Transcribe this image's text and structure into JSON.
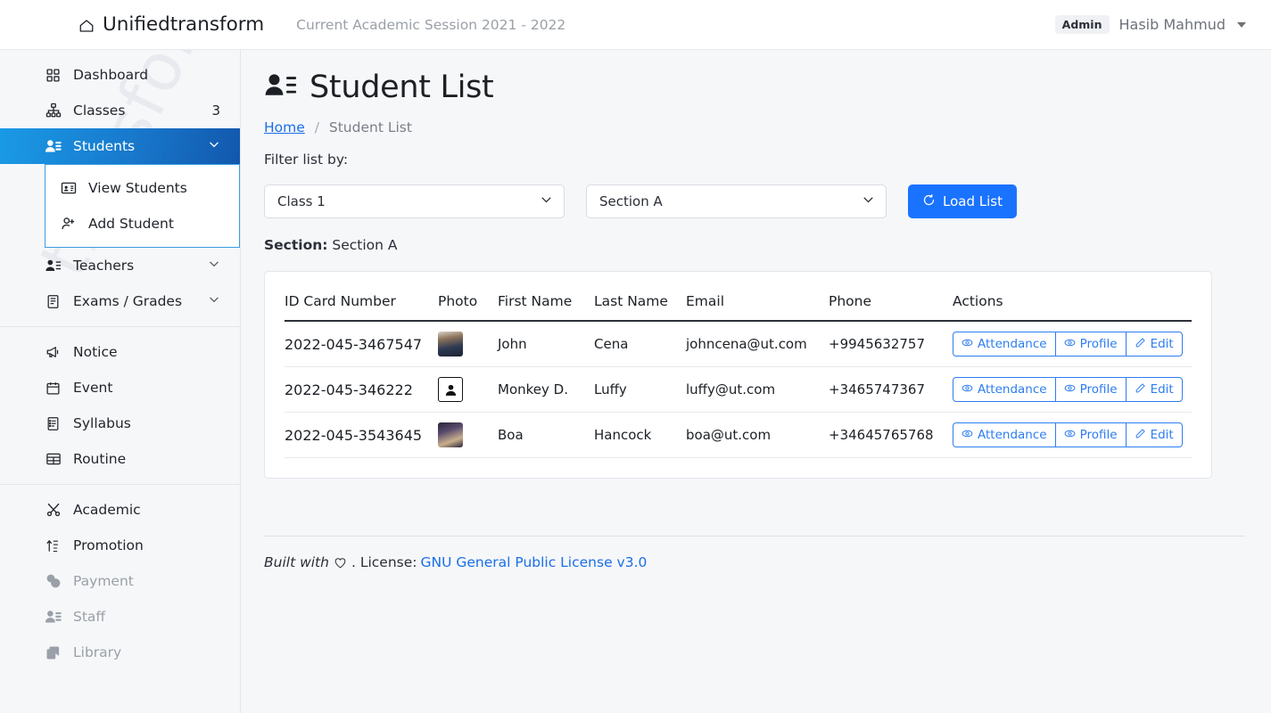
{
  "topbar": {
    "brand": "Unifiedtransform",
    "brand_icon": "home-icon",
    "session": "Current Academic Session 2021 - 2022",
    "role_badge": "Admin",
    "user_name": "Hasib Mahmud",
    "user_caret_icon": "chevron-down-icon"
  },
  "watermark": "transform",
  "sidebar": {
    "groups": [
      {
        "items": [
          {
            "label": "Dashboard",
            "icon": "grid-icon",
            "count": "",
            "expandable": false,
            "active": false,
            "muted": false
          },
          {
            "label": "Classes",
            "icon": "sitemap-icon",
            "count": "3",
            "expandable": false,
            "active": false,
            "muted": false
          },
          {
            "label": "Students",
            "icon": "users-icon",
            "count": "",
            "expandable": true,
            "active": true,
            "muted": false
          },
          {
            "label": "Teachers",
            "icon": "users-icon",
            "count": "",
            "expandable": true,
            "active": false,
            "muted": false
          },
          {
            "label": "Exams / Grades",
            "icon": "document-icon",
            "count": "",
            "expandable": true,
            "active": false,
            "muted": false
          }
        ]
      },
      {
        "items": [
          {
            "label": "Notice",
            "icon": "megaphone-icon",
            "count": "",
            "expandable": false,
            "active": false,
            "muted": false
          },
          {
            "label": "Event",
            "icon": "calendar-icon",
            "count": "",
            "expandable": false,
            "active": false,
            "muted": false
          },
          {
            "label": "Syllabus",
            "icon": "list-document-icon",
            "count": "",
            "expandable": false,
            "active": false,
            "muted": false
          },
          {
            "label": "Routine",
            "icon": "table-icon",
            "count": "",
            "expandable": false,
            "active": false,
            "muted": false
          }
        ]
      },
      {
        "items": [
          {
            "label": "Academic",
            "icon": "scissors-icon",
            "count": "",
            "expandable": false,
            "active": false,
            "muted": false
          },
          {
            "label": "Promotion",
            "icon": "sort-up-icon",
            "count": "",
            "expandable": false,
            "active": false,
            "muted": false
          },
          {
            "label": "Payment",
            "icon": "coins-icon",
            "count": "",
            "expandable": false,
            "active": false,
            "muted": true
          },
          {
            "label": "Staff",
            "icon": "users-icon",
            "count": "",
            "expandable": false,
            "active": false,
            "muted": true
          },
          {
            "label": "Library",
            "icon": "books-icon",
            "count": "",
            "expandable": false,
            "active": false,
            "muted": true
          }
        ]
      }
    ],
    "submenu": [
      {
        "label": "View Students",
        "icon": "id-card-icon"
      },
      {
        "label": "Add Student",
        "icon": "user-plus-icon"
      }
    ],
    "active_color": "#1878cc",
    "submenu_border_color": "#3a9ce0"
  },
  "main": {
    "title": "Student List",
    "title_icon": "users-list-icon",
    "breadcrumb": {
      "home": "Home",
      "separator": "/",
      "current": "Student List"
    },
    "filter_label": "Filter list by:",
    "class_select": {
      "value": "Class 1",
      "icon": "chevron-down-icon"
    },
    "section_select": {
      "value": "Section A",
      "icon": "chevron-down-icon"
    },
    "load_button": {
      "label": "Load List",
      "icon": "refresh-icon",
      "color": "#1a73ff"
    },
    "section_info": {
      "label": "Section:",
      "value": "Section A"
    },
    "table": {
      "columns": [
        "ID Card Number",
        "Photo",
        "First Name",
        "Last Name",
        "Email",
        "Phone",
        "Actions"
      ],
      "rows": [
        {
          "id_card": "2022-045-3467547",
          "photo": "photo1",
          "first_name": "John",
          "last_name": "Cena",
          "email": "johncena@ut.com",
          "phone": "+9945632757"
        },
        {
          "id_card": "2022-045-346222",
          "photo": "avatar-placeholder",
          "first_name": "Monkey D.",
          "last_name": "Luffy",
          "email": "luffy@ut.com",
          "phone": "+3465747367"
        },
        {
          "id_card": "2022-045-3543645",
          "photo": "photo3",
          "first_name": "Boa",
          "last_name": "Hancock",
          "email": "boa@ut.com",
          "phone": "+34645765768"
        }
      ],
      "actions": [
        {
          "label": "Attendance",
          "icon": "eye-icon"
        },
        {
          "label": "Profile",
          "icon": "eye-icon"
        },
        {
          "label": "Edit",
          "icon": "pencil-icon"
        }
      ],
      "action_color": "#2d7df0"
    }
  },
  "footer": {
    "built_with": "Built with",
    "heart_icon": "heart-icon",
    "license_label": ". License:",
    "license_link": "GNU General Public License v3.0"
  }
}
